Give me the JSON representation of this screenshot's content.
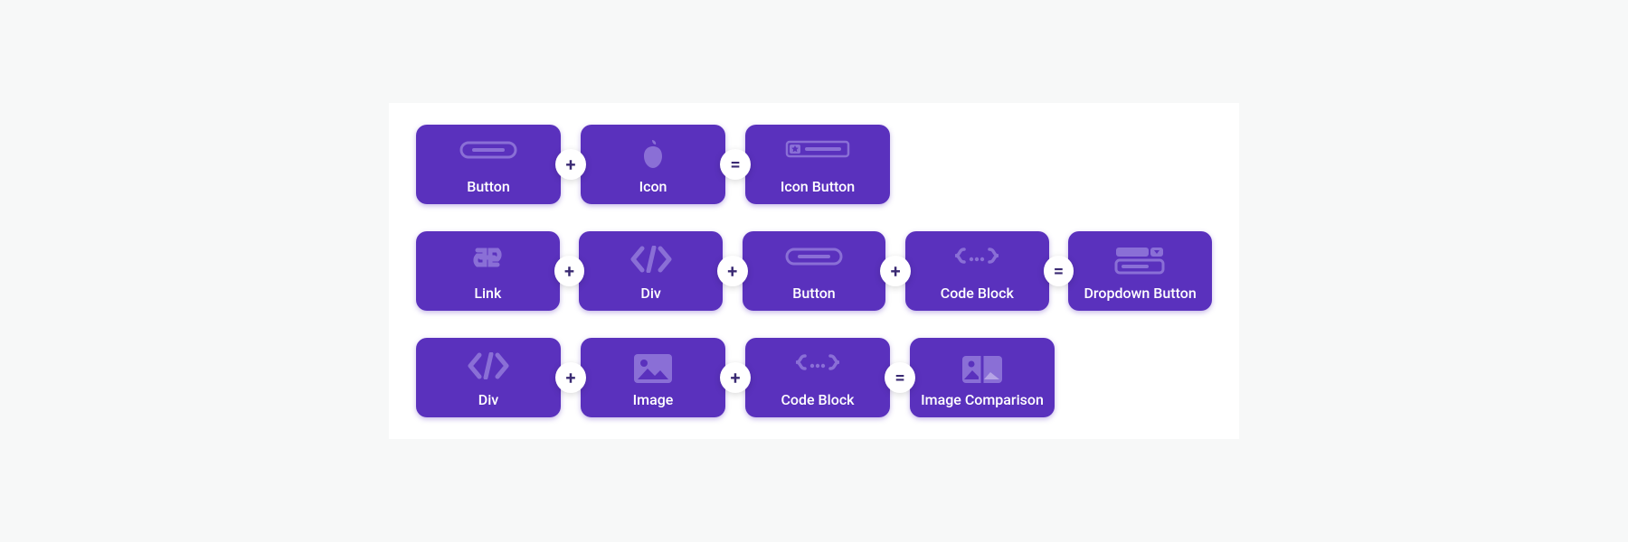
{
  "operators": {
    "plus": "+",
    "equals": "="
  },
  "colors": {
    "card_bg": "#5a31bd",
    "icon_fg": "#8a6fd6"
  },
  "rows": [
    {
      "items": [
        {
          "icon": "button",
          "label": "Button"
        },
        {
          "op": "plus"
        },
        {
          "icon": "icon",
          "label": "Icon"
        },
        {
          "op": "equals"
        },
        {
          "icon": "icon-button",
          "label": "Icon Button"
        }
      ]
    },
    {
      "items": [
        {
          "icon": "link",
          "label": "Link"
        },
        {
          "op": "plus"
        },
        {
          "icon": "div",
          "label": "Div"
        },
        {
          "op": "plus"
        },
        {
          "icon": "button",
          "label": "Button"
        },
        {
          "op": "plus"
        },
        {
          "icon": "code",
          "label": "Code Block"
        },
        {
          "op": "equals"
        },
        {
          "icon": "dropdown",
          "label": "Dropdown Button"
        }
      ]
    },
    {
      "items": [
        {
          "icon": "div",
          "label": "Div"
        },
        {
          "op": "plus"
        },
        {
          "icon": "image",
          "label": "Image"
        },
        {
          "op": "plus"
        },
        {
          "icon": "code",
          "label": "Code Block"
        },
        {
          "op": "equals"
        },
        {
          "icon": "image-comparison",
          "label": "Image Comparison"
        }
      ]
    }
  ]
}
